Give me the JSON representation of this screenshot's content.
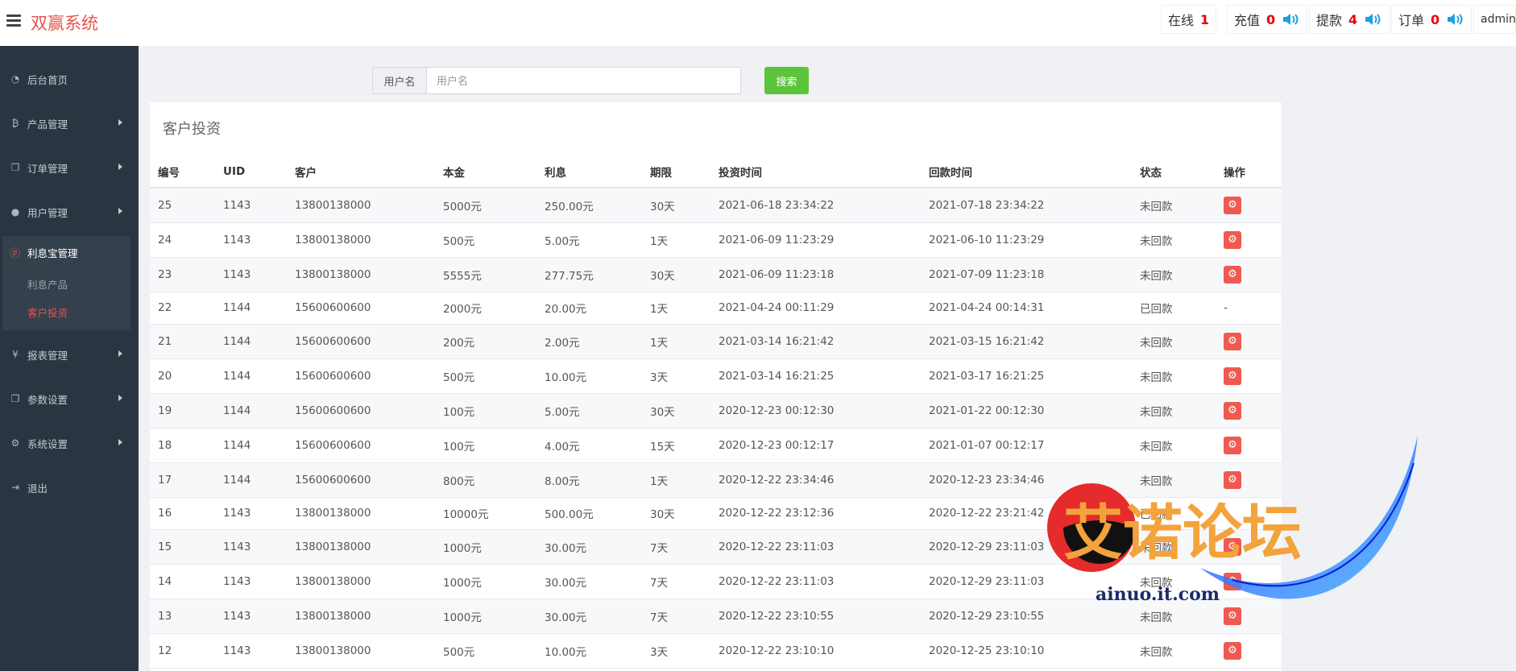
{
  "header": {
    "brand": "双赢系统",
    "stats": [
      {
        "label": "在线",
        "value": "1"
      },
      {
        "label": "充值",
        "value": "0"
      },
      {
        "label": "提款",
        "value": "4"
      },
      {
        "label": "订单",
        "value": "0"
      }
    ],
    "user": "admin",
    "colors": {
      "brand": "#e5544b",
      "stat_number": "#e00000",
      "speaker": "#1ba1e2"
    }
  },
  "sidebar": {
    "items": [
      {
        "label": "后台首页",
        "icon": "dashboard-icon"
      },
      {
        "label": "产品管理",
        "icon": "bitcoin-icon"
      },
      {
        "label": "订单管理",
        "icon": "copy-icon"
      },
      {
        "label": "用户管理",
        "icon": "user-icon"
      },
      {
        "label": "利息宝管理",
        "icon": "pinterest-icon"
      },
      {
        "label": "报表管理",
        "icon": "yen-icon"
      },
      {
        "label": "参数设置",
        "icon": "copy-icon"
      },
      {
        "label": "系统设置",
        "icon": "gears-icon"
      },
      {
        "label": "退出",
        "icon": "sign-out-icon"
      }
    ],
    "submenu": [
      {
        "label": "利息产品",
        "active": false
      },
      {
        "label": "客户投资",
        "active": true
      }
    ]
  },
  "search": {
    "addon_label": "用户名",
    "placeholder": "用户名",
    "button_label": "搜索"
  },
  "panel": {
    "title": "客户投资",
    "columns": [
      "编号",
      "UID",
      "客户",
      "本金",
      "利息",
      "期限",
      "投资时间",
      "回款时间",
      "状态",
      "操作"
    ],
    "rows": [
      [
        "25",
        "1143",
        "13800138000",
        "5000元",
        "250.00元",
        "30天",
        "2021-06-18 23:34:22",
        "2021-07-18 23:34:22",
        "未回款",
        "action"
      ],
      [
        "24",
        "1143",
        "13800138000",
        "500元",
        "5.00元",
        "1天",
        "2021-06-09 11:23:29",
        "2021-06-10 11:23:29",
        "未回款",
        "action"
      ],
      [
        "23",
        "1143",
        "13800138000",
        "5555元",
        "277.75元",
        "30天",
        "2021-06-09 11:23:18",
        "2021-07-09 11:23:18",
        "未回款",
        "action"
      ],
      [
        "22",
        "1144",
        "15600600600",
        "2000元",
        "20.00元",
        "1天",
        "2021-04-24 00:11:29",
        "2021-04-24 00:14:31",
        "已回款",
        "-"
      ],
      [
        "21",
        "1144",
        "15600600600",
        "200元",
        "2.00元",
        "1天",
        "2021-03-14 16:21:42",
        "2021-03-15 16:21:42",
        "未回款",
        "action"
      ],
      [
        "20",
        "1144",
        "15600600600",
        "500元",
        "10.00元",
        "3天",
        "2021-03-14 16:21:25",
        "2021-03-17 16:21:25",
        "未回款",
        "action"
      ],
      [
        "19",
        "1144",
        "15600600600",
        "100元",
        "5.00元",
        "30天",
        "2020-12-23 00:12:30",
        "2021-01-22 00:12:30",
        "未回款",
        "action"
      ],
      [
        "18",
        "1144",
        "15600600600",
        "100元",
        "4.00元",
        "15天",
        "2020-12-23 00:12:17",
        "2021-01-07 00:12:17",
        "未回款",
        "action"
      ],
      [
        "17",
        "1144",
        "15600600600",
        "800元",
        "8.00元",
        "1天",
        "2020-12-22 23:34:46",
        "2020-12-23 23:34:46",
        "未回款",
        "action"
      ],
      [
        "16",
        "1143",
        "13800138000",
        "10000元",
        "500.00元",
        "30天",
        "2020-12-22 23:12:36",
        "2020-12-22 23:21:42",
        "已回款",
        "-"
      ],
      [
        "15",
        "1143",
        "13800138000",
        "1000元",
        "30.00元",
        "7天",
        "2020-12-22 23:11:03",
        "2020-12-29 23:11:03",
        "未回款",
        "action"
      ],
      [
        "14",
        "1143",
        "13800138000",
        "1000元",
        "30.00元",
        "7天",
        "2020-12-22 23:11:03",
        "2020-12-29 23:11:03",
        "未回款",
        "action"
      ],
      [
        "13",
        "1143",
        "13800138000",
        "1000元",
        "30.00元",
        "7天",
        "2020-12-22 23:10:55",
        "2020-12-29 23:10:55",
        "未回款",
        "action"
      ],
      [
        "12",
        "1143",
        "13800138000",
        "500元",
        "10.00元",
        "3天",
        "2020-12-22 23:10:10",
        "2020-12-25 23:10:10",
        "未回款",
        "action"
      ]
    ]
  },
  "watermark": {
    "title": "艾诺论坛",
    "url": "ainuo.it.com"
  }
}
